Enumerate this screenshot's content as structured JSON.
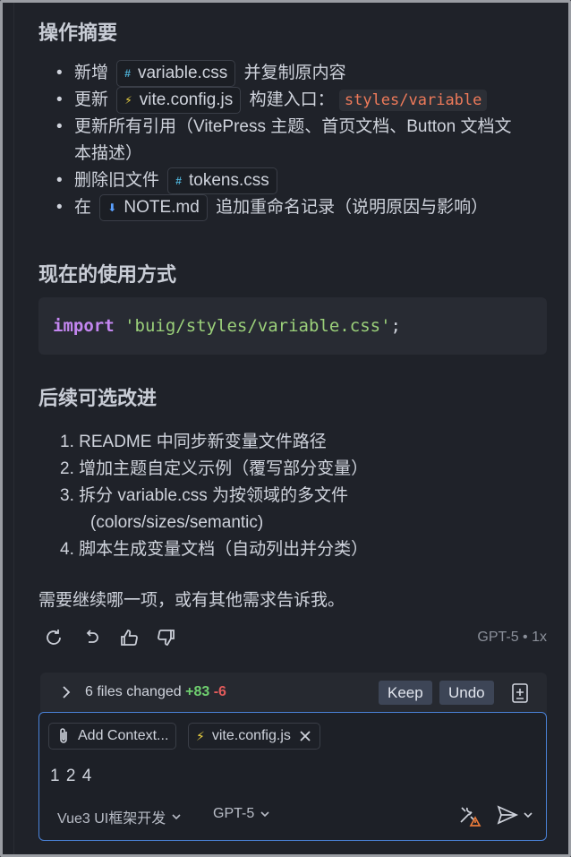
{
  "sections": {
    "summary_title": "操作摘要",
    "usage_title": "现在的使用方式",
    "next_title": "后续可选改进"
  },
  "summary": {
    "item1_pre": "新增",
    "item1_file": "variable.css",
    "item1_post": "并复制原内容",
    "item2_pre": "更新",
    "item2_file": "vite.config.js",
    "item2_mid": "构建入口：",
    "item2_code": "styles/variable",
    "item3_line1": "更新所有引用（VitePress 主题、首页文档、Button 文档文",
    "item3_line2": "本描述）",
    "item4_pre": "删除旧文件",
    "item4_file": "tokens.css",
    "item5_pre": "在",
    "item5_file": "NOTE.md",
    "item5_post": "追加重命名记录（说明原因与影响）"
  },
  "code": {
    "keyword": "import",
    "string": "'buig/styles/variable.css'",
    "punct": ";"
  },
  "next_steps": {
    "s1": "1. README 中同步新变量文件路径",
    "s2": "2. 增加主题自定义示例（覆写部分变量）",
    "s3_line1": "3. 拆分 variable.css 为按领域的多文件",
    "s3_line2": "(colors/sizes/semantic)",
    "s4": "4. 脚本生成变量文档（自动列出并分类）"
  },
  "question": "需要继续哪一项，或有其他需求告诉我。",
  "model_info": "GPT-5 • 1x",
  "changes": {
    "label": "6 files changed",
    "plus": "+83",
    "minus": "-6",
    "keep": "Keep",
    "undo": "Undo"
  },
  "input": {
    "add_context": "Add Context...",
    "file_chip": "vite.config.js",
    "text": "1 2 4",
    "mode": "Vue3 UI框架开发",
    "model": "GPT-5"
  },
  "icons": [
    "refresh-icon",
    "undo-icon",
    "thumbs-up-icon",
    "thumbs-down-icon",
    "chevron-right-icon",
    "document-icon",
    "paperclip-icon",
    "bolt-icon",
    "close-icon",
    "tools-icon",
    "send-icon",
    "chevron-down-icon"
  ],
  "colors": {
    "background": "#1f2229",
    "accent_border": "#4a82d8",
    "plus": "#6fcf6f",
    "minus": "#e25b5b",
    "keyword": "#c386f0",
    "string": "#9bd07a",
    "inline_code": "#ee7a5a"
  }
}
